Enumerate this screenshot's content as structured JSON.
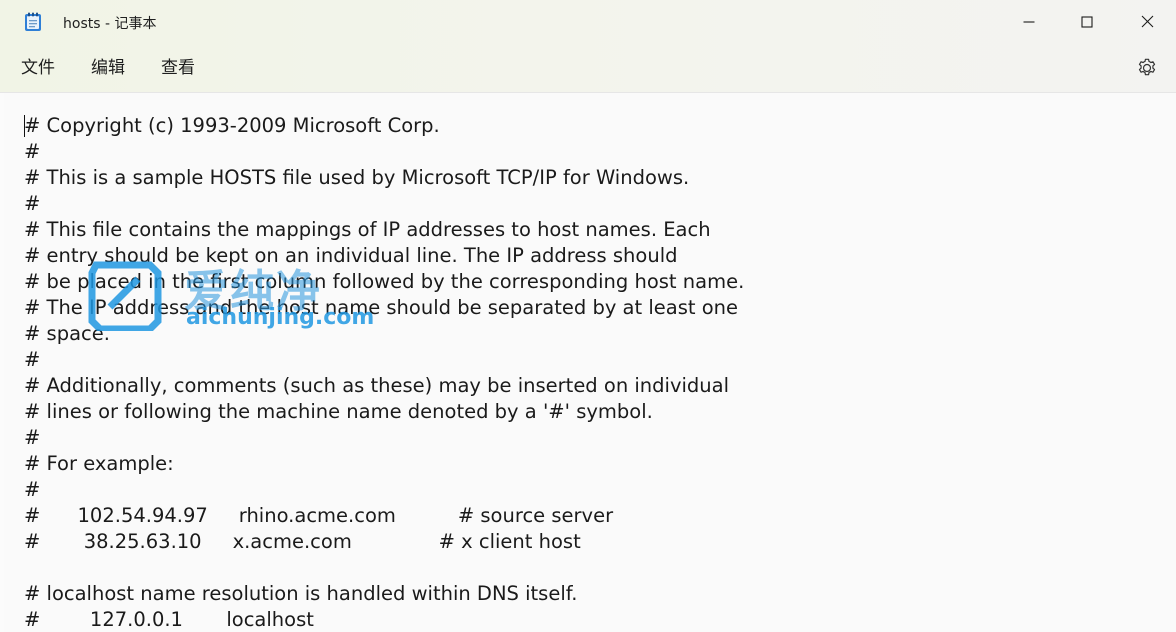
{
  "window": {
    "title": "hosts - 记事本",
    "icon": "notepad-icon",
    "controls": [
      "minimize-icon",
      "maximize-icon",
      "close-icon"
    ]
  },
  "menu": {
    "file": "文件",
    "edit": "编辑",
    "view": "查看",
    "settings_icon": "gear-icon"
  },
  "editor": {
    "lines": [
      "# Copyright (c) 1993-2009 Microsoft Corp.",
      "#",
      "# This is a sample HOSTS file used by Microsoft TCP/IP for Windows.",
      "#",
      "# This file contains the mappings of IP addresses to host names. Each",
      "# entry should be kept on an individual line. The IP address should",
      "# be placed in the first column followed by the corresponding host name.",
      "# The IP address and the host name should be separated by at least one",
      "# space.",
      "#",
      "# Additionally, comments (such as these) may be inserted on individual",
      "# lines or following the machine name denoted by a '#' symbol.",
      "#",
      "# For example:",
      "#",
      "#      102.54.94.97     rhino.acme.com          # source server",
      "#       38.25.63.10     x.acme.com              # x client host",
      "",
      "# localhost name resolution is handled within DNS itself.",
      "#        127.0.0.1       localhost"
    ]
  },
  "watermark": {
    "cn": "爱纯净",
    "url": "aichunjing.com"
  },
  "colors": {
    "accent": "#1e96e1",
    "titlebar_bg": "#f1f4e6",
    "editor_bg": "#fafafa"
  }
}
